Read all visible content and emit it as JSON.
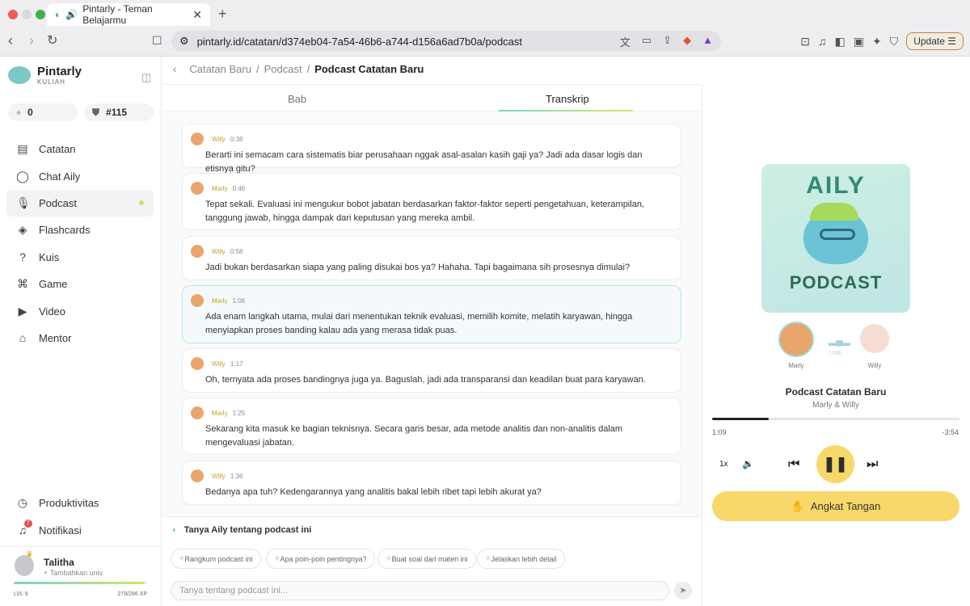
{
  "browser": {
    "tab_title": "Pintarly - Teman Belajarmu",
    "url": "pintarly.id/catatan/d374eb04-7a54-46b6-a744-d156a6ad7b0a/podcast",
    "update_label": "Update"
  },
  "app": {
    "name": "Pintarly",
    "subtitle": "KULIAH",
    "streak": "0",
    "rank": "#115"
  },
  "sidebar": {
    "items": [
      {
        "label": "Catatan",
        "icon": "note-icon"
      },
      {
        "label": "Chat Aily",
        "icon": "chat-icon"
      },
      {
        "label": "Podcast",
        "icon": "microphone-icon"
      },
      {
        "label": "Flashcards",
        "icon": "flashcards-icon"
      },
      {
        "label": "Kuis",
        "icon": "question-icon"
      },
      {
        "label": "Game",
        "icon": "gamepad-icon"
      },
      {
        "label": "Video",
        "icon": "video-icon"
      },
      {
        "label": "Mentor",
        "icon": "graduation-cap-icon"
      }
    ],
    "bottom": [
      {
        "label": "Produktivitas",
        "icon": "timer-icon"
      },
      {
        "label": "Notifikasi",
        "icon": "bell-icon"
      }
    ],
    "notif_count": "7"
  },
  "user": {
    "name": "Talitha",
    "add_univ": "+ Tambahkan univ",
    "level": "LVL 9",
    "xp": "279/286 XP",
    "xp_fraction": 0.975
  },
  "breadcrumb": {
    "items": [
      "Catatan Baru",
      "Podcast"
    ],
    "current": "Podcast Catatan Baru"
  },
  "tabs": {
    "bab": "Bab",
    "transkrip": "Transkrip"
  },
  "transcript": [
    {
      "speaker": "Willy",
      "time": "0:38",
      "text": "Berarti ini semacam cara sistematis biar perusahaan nggak asal-asalan kasih gaji ya? Jadi ada dasar logis dan etisnya gitu?"
    },
    {
      "speaker": "Marly",
      "time": "0:46",
      "text": "Tepat sekali. Evaluasi ini mengukur bobot jabatan berdasarkan faktor-faktor seperti pengetahuan, keterampilan, tanggung jawab, hingga dampak dari keputusan yang mereka ambil."
    },
    {
      "speaker": "Willy",
      "time": "0:58",
      "text": "Jadi bukan berdasarkan siapa yang paling disukai bos ya? Hahaha. Tapi bagaimana sih prosesnya dimulai?"
    },
    {
      "speaker": "Marly",
      "time": "1:06",
      "text": "Ada enam langkah utama, mulai dari menentukan teknik evaluasi, memilih komite, melatih karyawan, hingga menyiapkan proses banding kalau ada yang merasa tidak puas."
    },
    {
      "speaker": "Willy",
      "time": "1:17",
      "text": "Oh, ternyata ada proses bandingnya juga ya. Baguslah, jadi ada transparansi dan keadilan buat para karyawan."
    },
    {
      "speaker": "Marly",
      "time": "1:25",
      "text": "Sekarang kita masuk ke bagian teknisnya. Secara garis besar, ada metode analitis dan non-analitis dalam mengevaluasi jabatan."
    },
    {
      "speaker": "Willy",
      "time": "1:36",
      "text": "Bedanya apa tuh? Kedengarannya yang analitis bakal lebih ribet tapi lebih akurat ya?"
    }
  ],
  "ask": {
    "title": "Tanya Aily tentang podcast ini",
    "chips": [
      "Rangkum podcast ini",
      "Apa poin-poin pentingnya?",
      "Buat soal dari materi ini",
      "Jelaskan lebih detail"
    ],
    "placeholder": "Tanya tentang podcast ini..."
  },
  "player": {
    "cover_title": "AILY",
    "cover_sub": "PODCAST",
    "speakers": [
      "Marly",
      "Willy"
    ],
    "live": "LIVE",
    "title": "Podcast Catatan Baru",
    "subtitle": "Marly & Willy",
    "elapsed": "1:09",
    "remaining": "-3:54",
    "progress": 0.23,
    "speed": "1x",
    "raise_hand": "Angkat Tangan"
  }
}
